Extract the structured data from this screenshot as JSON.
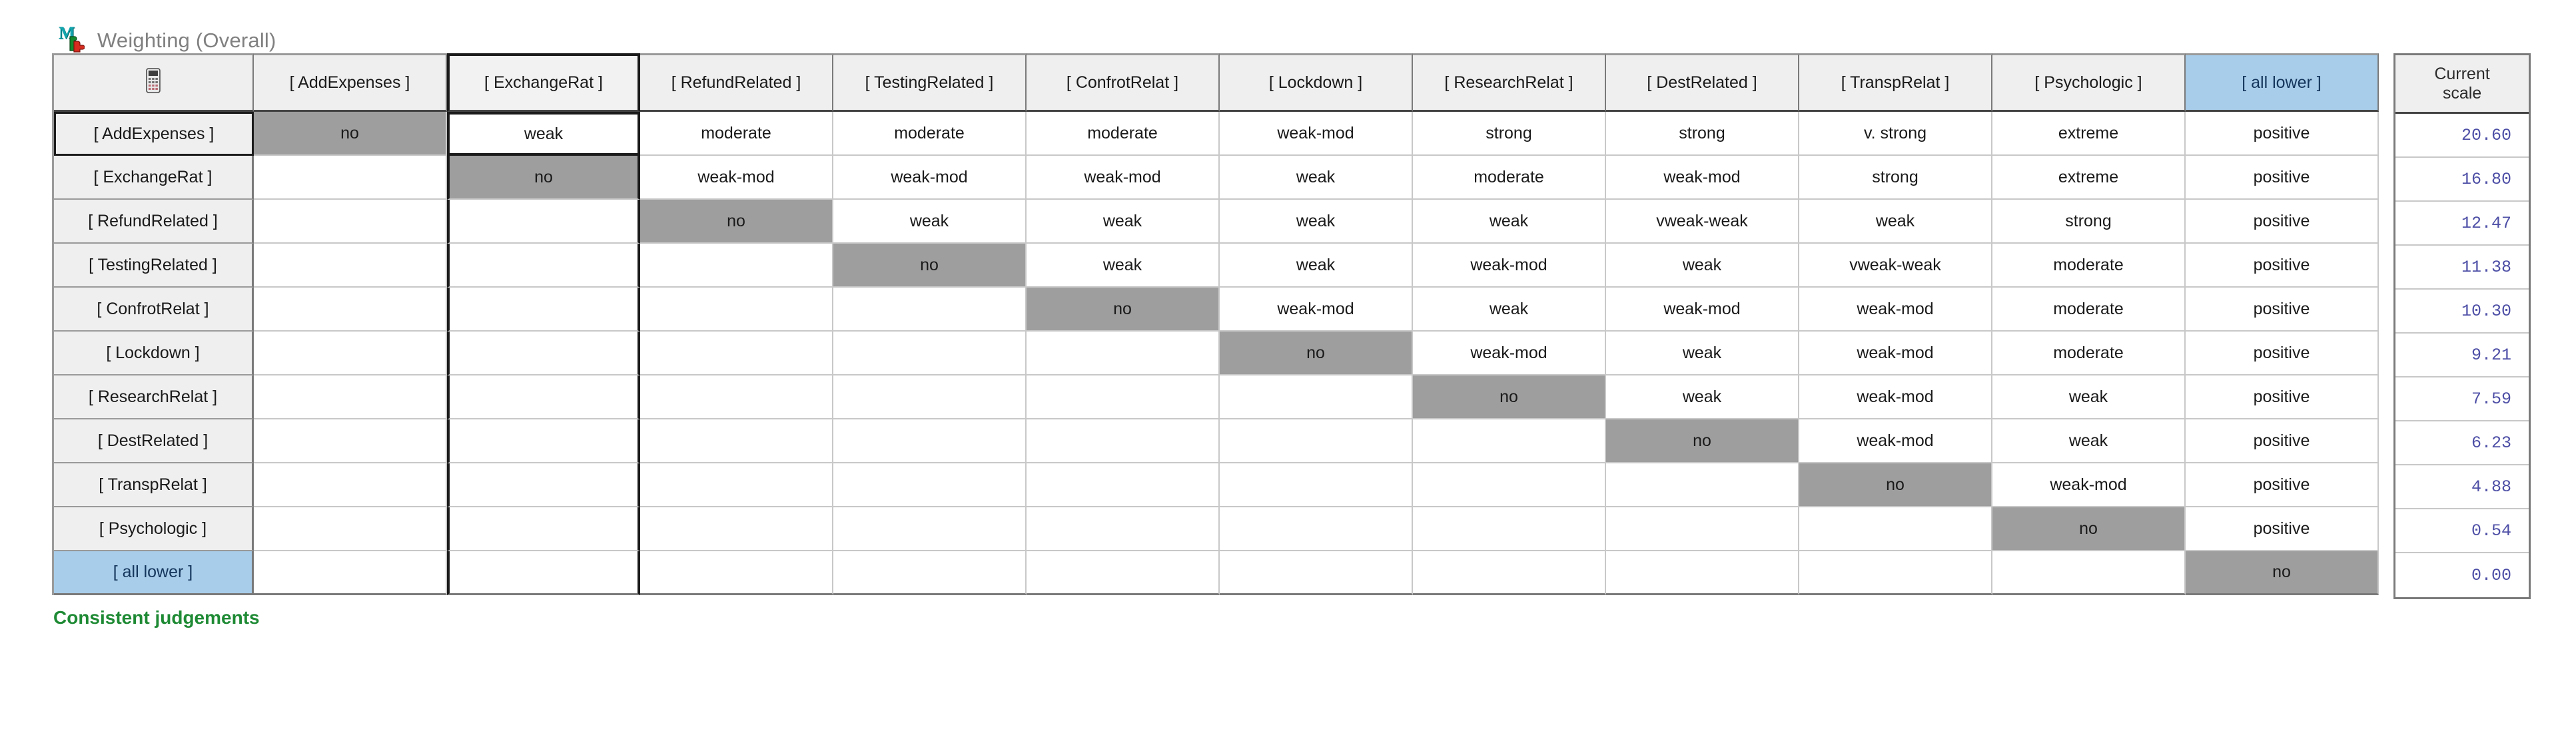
{
  "header": {
    "icon": "makeitrational-logo-icon",
    "title": "Weighting (Overall)"
  },
  "table": {
    "corner_icon": "calculator-icon",
    "scale_column_header": "Current\nscale",
    "scale_column_header_line1": "Current",
    "scale_column_header_line2": "scale",
    "columns": [
      "[ AddExpenses ]",
      "[ ExchangeRat ]",
      "[ RefundRelated ]",
      "[ TestingRelated ]",
      "[ ConfrotRelat ]",
      "[ Lockdown ]",
      "[ ResearchRelat ]",
      "[ DestRelated ]",
      "[ TranspRelat ]",
      "[ Psychologic ]",
      "[ all lower ]"
    ],
    "rows": [
      "[ AddExpenses ]",
      "[ ExchangeRat ]",
      "[ RefundRelated ]",
      "[ TestingRelated ]",
      "[ ConfrotRelat ]",
      "[ Lockdown ]",
      "[ ResearchRelat ]",
      "[ DestRelated ]",
      "[ TranspRelat ]",
      "[ Psychologic ]",
      "[ all lower ]"
    ],
    "selected_column_index": 1,
    "selected_row_index": 0,
    "highlighted_column_index": 10,
    "highlighted_row_index": 10,
    "cells": [
      [
        "no",
        "weak",
        "moderate",
        "moderate",
        "moderate",
        "weak-mod",
        "strong",
        "strong",
        "v. strong",
        "extreme",
        "positive"
      ],
      [
        "",
        "no",
        "weak-mod",
        "weak-mod",
        "weak-mod",
        "weak",
        "moderate",
        "weak-mod",
        "strong",
        "extreme",
        "positive"
      ],
      [
        "",
        "",
        "no",
        "weak",
        "weak",
        "weak",
        "weak",
        "vweak-weak",
        "weak",
        "strong",
        "positive"
      ],
      [
        "",
        "",
        "",
        "no",
        "weak",
        "weak",
        "weak-mod",
        "weak",
        "vweak-weak",
        "moderate",
        "positive"
      ],
      [
        "",
        "",
        "",
        "",
        "no",
        "weak-mod",
        "weak",
        "weak-mod",
        "weak-mod",
        "moderate",
        "positive"
      ],
      [
        "",
        "",
        "",
        "",
        "",
        "no",
        "weak-mod",
        "weak",
        "weak-mod",
        "moderate",
        "positive"
      ],
      [
        "",
        "",
        "",
        "",
        "",
        "",
        "no",
        "weak",
        "weak-mod",
        "weak",
        "positive"
      ],
      [
        "",
        "",
        "",
        "",
        "",
        "",
        "",
        "no",
        "weak-mod",
        "weak",
        "positive"
      ],
      [
        "",
        "",
        "",
        "",
        "",
        "",
        "",
        "",
        "no",
        "weak-mod",
        "positive"
      ],
      [
        "",
        "",
        "",
        "",
        "",
        "",
        "",
        "",
        "",
        "no",
        "positive"
      ],
      [
        "",
        "",
        "",
        "",
        "",
        "",
        "",
        "",
        "",
        "",
        "no"
      ]
    ],
    "current_scale": [
      "20.60",
      "16.80",
      "12.47",
      "11.38",
      "10.30",
      "9.21",
      "7.59",
      "6.23",
      "4.88",
      "0.54",
      "0.00"
    ]
  },
  "footer": {
    "status": "Consistent judgements"
  },
  "colors": {
    "highlight_blue": "#a8cdea",
    "diagonal_gray": "#9e9e9e",
    "header_gray": "#efefef",
    "status_green": "#1e8a34",
    "scale_value_blue": "#4e4fa6",
    "title_gray": "#808080"
  }
}
